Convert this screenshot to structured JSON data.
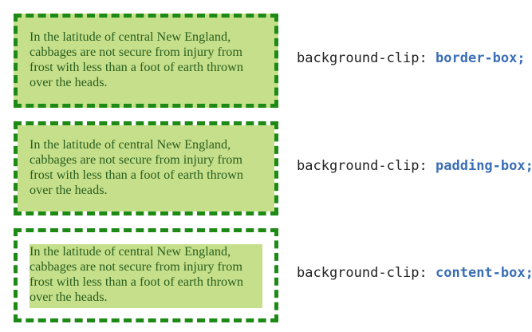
{
  "demo_text": "In the latitude of central New England, cabbages are not secure from injury from frost with less than a foot of earth thrown over the heads.",
  "colors": {
    "border": "#1e8a16",
    "background": "#c5df8b",
    "text": "#2a5f1e",
    "value": "#3b6fb6"
  },
  "rows": [
    {
      "property": "background-clip:",
      "value": "border-box;"
    },
    {
      "property": "background-clip:",
      "value": "padding-box;"
    },
    {
      "property": "background-clip:",
      "value": "content-box;"
    }
  ]
}
